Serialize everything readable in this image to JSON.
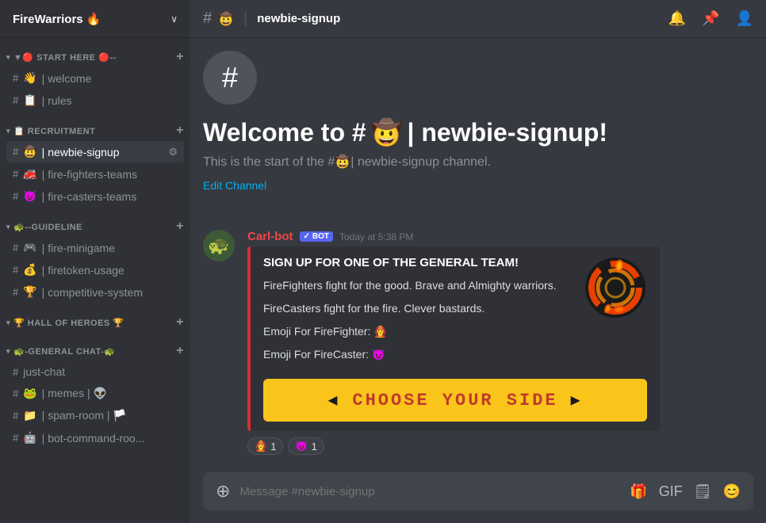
{
  "server": {
    "name": "FireWarriors 🔥",
    "chevron": "∨"
  },
  "categories": [
    {
      "id": "start-here",
      "label": "▼🔴 START HERE 🔴--",
      "channels": [
        {
          "id": "welcome",
          "prefix": "👋",
          "name": "| welcome",
          "active": false
        },
        {
          "id": "rules",
          "prefix": "📋",
          "name": "| rules",
          "active": false
        }
      ]
    },
    {
      "id": "recruitment",
      "label": "📋 RECRUITMENT",
      "channels": [
        {
          "id": "newbie-signup",
          "prefix": "🤠",
          "name": "| newbie-signup",
          "settings": "⚙",
          "active": true
        },
        {
          "id": "fire-fighters-teams",
          "prefix": "🚒",
          "name": "| fire-fighters-teams",
          "active": false
        },
        {
          "id": "fire-casters-teams",
          "prefix": "😈",
          "name": "| fire-casters-teams",
          "active": false
        }
      ]
    },
    {
      "id": "guideline",
      "label": "🐢--GUIDELINE",
      "channels": [
        {
          "id": "fire-minigame",
          "prefix": "🎮",
          "name": "| fire-minigame",
          "active": false
        },
        {
          "id": "firetoken-usage",
          "prefix": "💰",
          "name": "| firetoken-usage",
          "active": false
        },
        {
          "id": "competitive-system",
          "prefix": "🏆",
          "name": "| competitive-system",
          "active": false
        }
      ]
    },
    {
      "id": "hall-of-heroes",
      "label": "🏆 HALL OF HEROES 🏆",
      "channels": []
    },
    {
      "id": "general-chat",
      "label": "🐢-GENERAL CHAT-🐢",
      "channels": [
        {
          "id": "just-chat",
          "prefix": "",
          "name": "just-chat",
          "active": false
        },
        {
          "id": "memes",
          "prefix": "🐸",
          "name": "| memes | 👽",
          "active": false
        },
        {
          "id": "spam-room",
          "prefix": "📁",
          "name": "| spam-room | 🏳️",
          "active": false
        },
        {
          "id": "bot-command-roo",
          "prefix": "🤖",
          "name": "| bot-command-roo...",
          "active": false
        }
      ]
    }
  ],
  "topbar": {
    "channel_name": "newbie-signup",
    "icons": [
      "🔔",
      "📌",
      "👤"
    ]
  },
  "welcome": {
    "title_prefix": "Welcome to #",
    "title_emoji": "🤠",
    "title_suffix": "| newbie-signup!",
    "subtitle_prefix": "This is the start of the #",
    "subtitle_emoji": "🤠",
    "subtitle_suffix": "| newbie-signup channel.",
    "edit_label": "Edit Channel"
  },
  "message": {
    "author": "Carl-bot",
    "author_color": "#f04747",
    "badge_label": "BOT",
    "timestamp": "Today at 5:38 PM",
    "avatar_emoji": "🐢",
    "embed": {
      "border_color": "#d63031",
      "title": "SIGN UP FOR ONE OF THE GENERAL TEAM!",
      "description1": "FireFighters fight for the good. Brave and Almighty warriors.",
      "description2": "FireCasters fight for the fire. Clever bastards.",
      "emoji_firefighter_label": "Emoji For FireFighter: 👩‍🚒",
      "emoji_firecaster_label": "Emoji For FireCaster: 😈",
      "choose_btn_label": "CHOOSE YOUR SIDE",
      "arrow_left": "❮",
      "arrow_right": "❯"
    },
    "reactions": [
      {
        "emoji": "👩‍🚒",
        "count": "1"
      },
      {
        "emoji": "😈",
        "count": "1"
      }
    ]
  },
  "input": {
    "placeholder": "Message #newbie-signup"
  }
}
